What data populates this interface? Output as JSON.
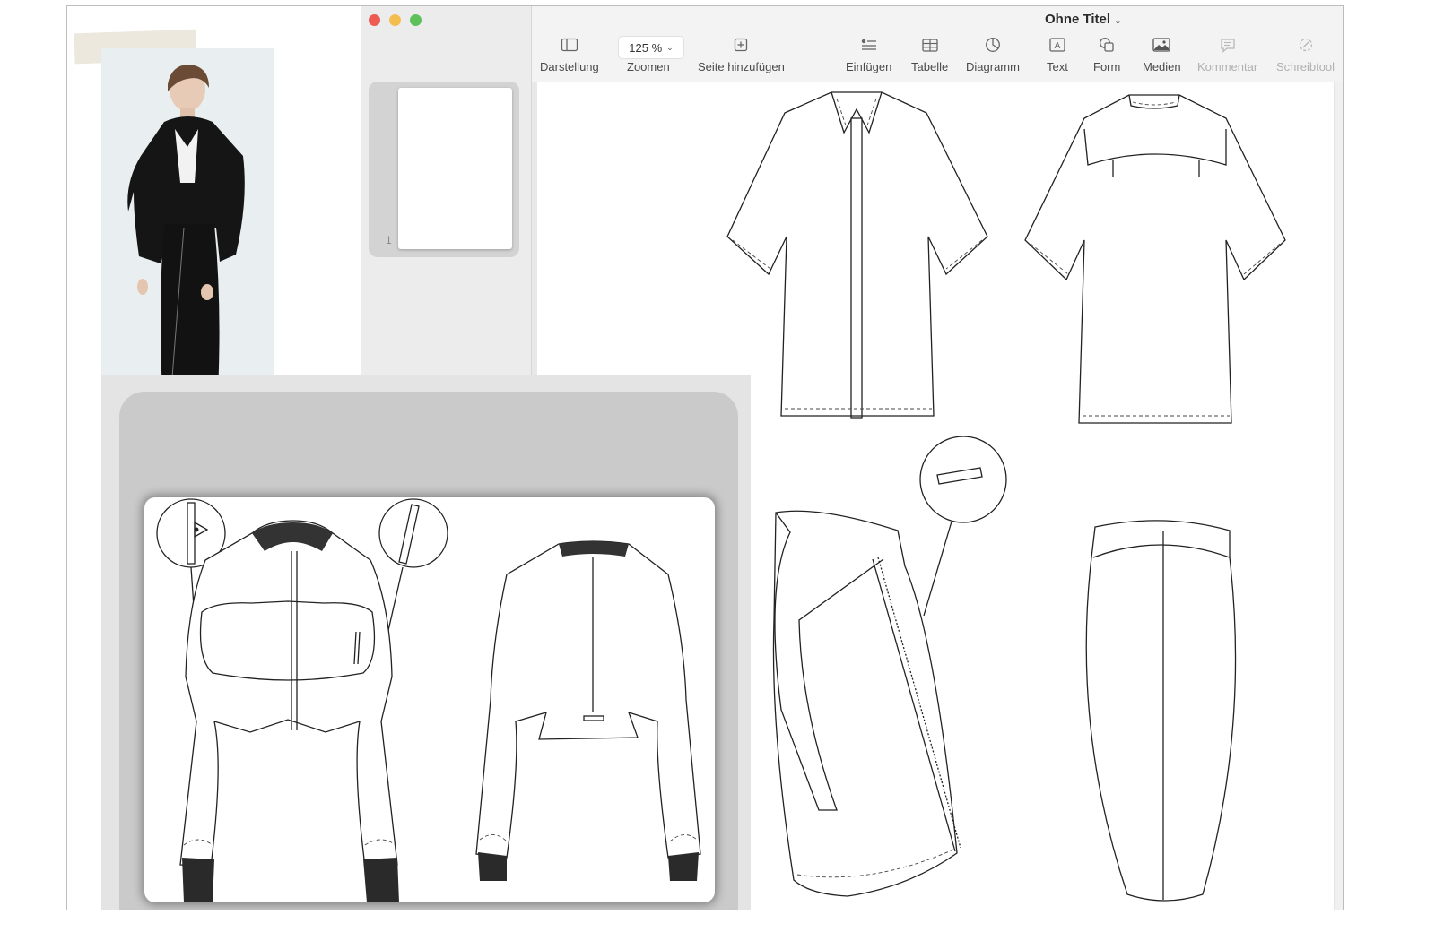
{
  "window": {
    "title": "Ohne Titel",
    "colors": {
      "close": "#ed5b53",
      "minimize": "#f4be4f",
      "zoom": "#5ec15b"
    }
  },
  "toolbar": {
    "view_label": "Darstellung",
    "zoom_value": "125 %",
    "zoom_label": "Zoomen",
    "add_page_label": "Seite hinzufügen",
    "insert_label": "Einfügen",
    "table_label": "Tabelle",
    "chart_label": "Diagramm",
    "text_label": "Text",
    "shape_label": "Form",
    "media_label": "Medien",
    "comment_label": "Kommentar",
    "writing_tools_label": "Schreibtool"
  },
  "sidebar": {
    "pages": [
      {
        "number": "1"
      }
    ]
  }
}
